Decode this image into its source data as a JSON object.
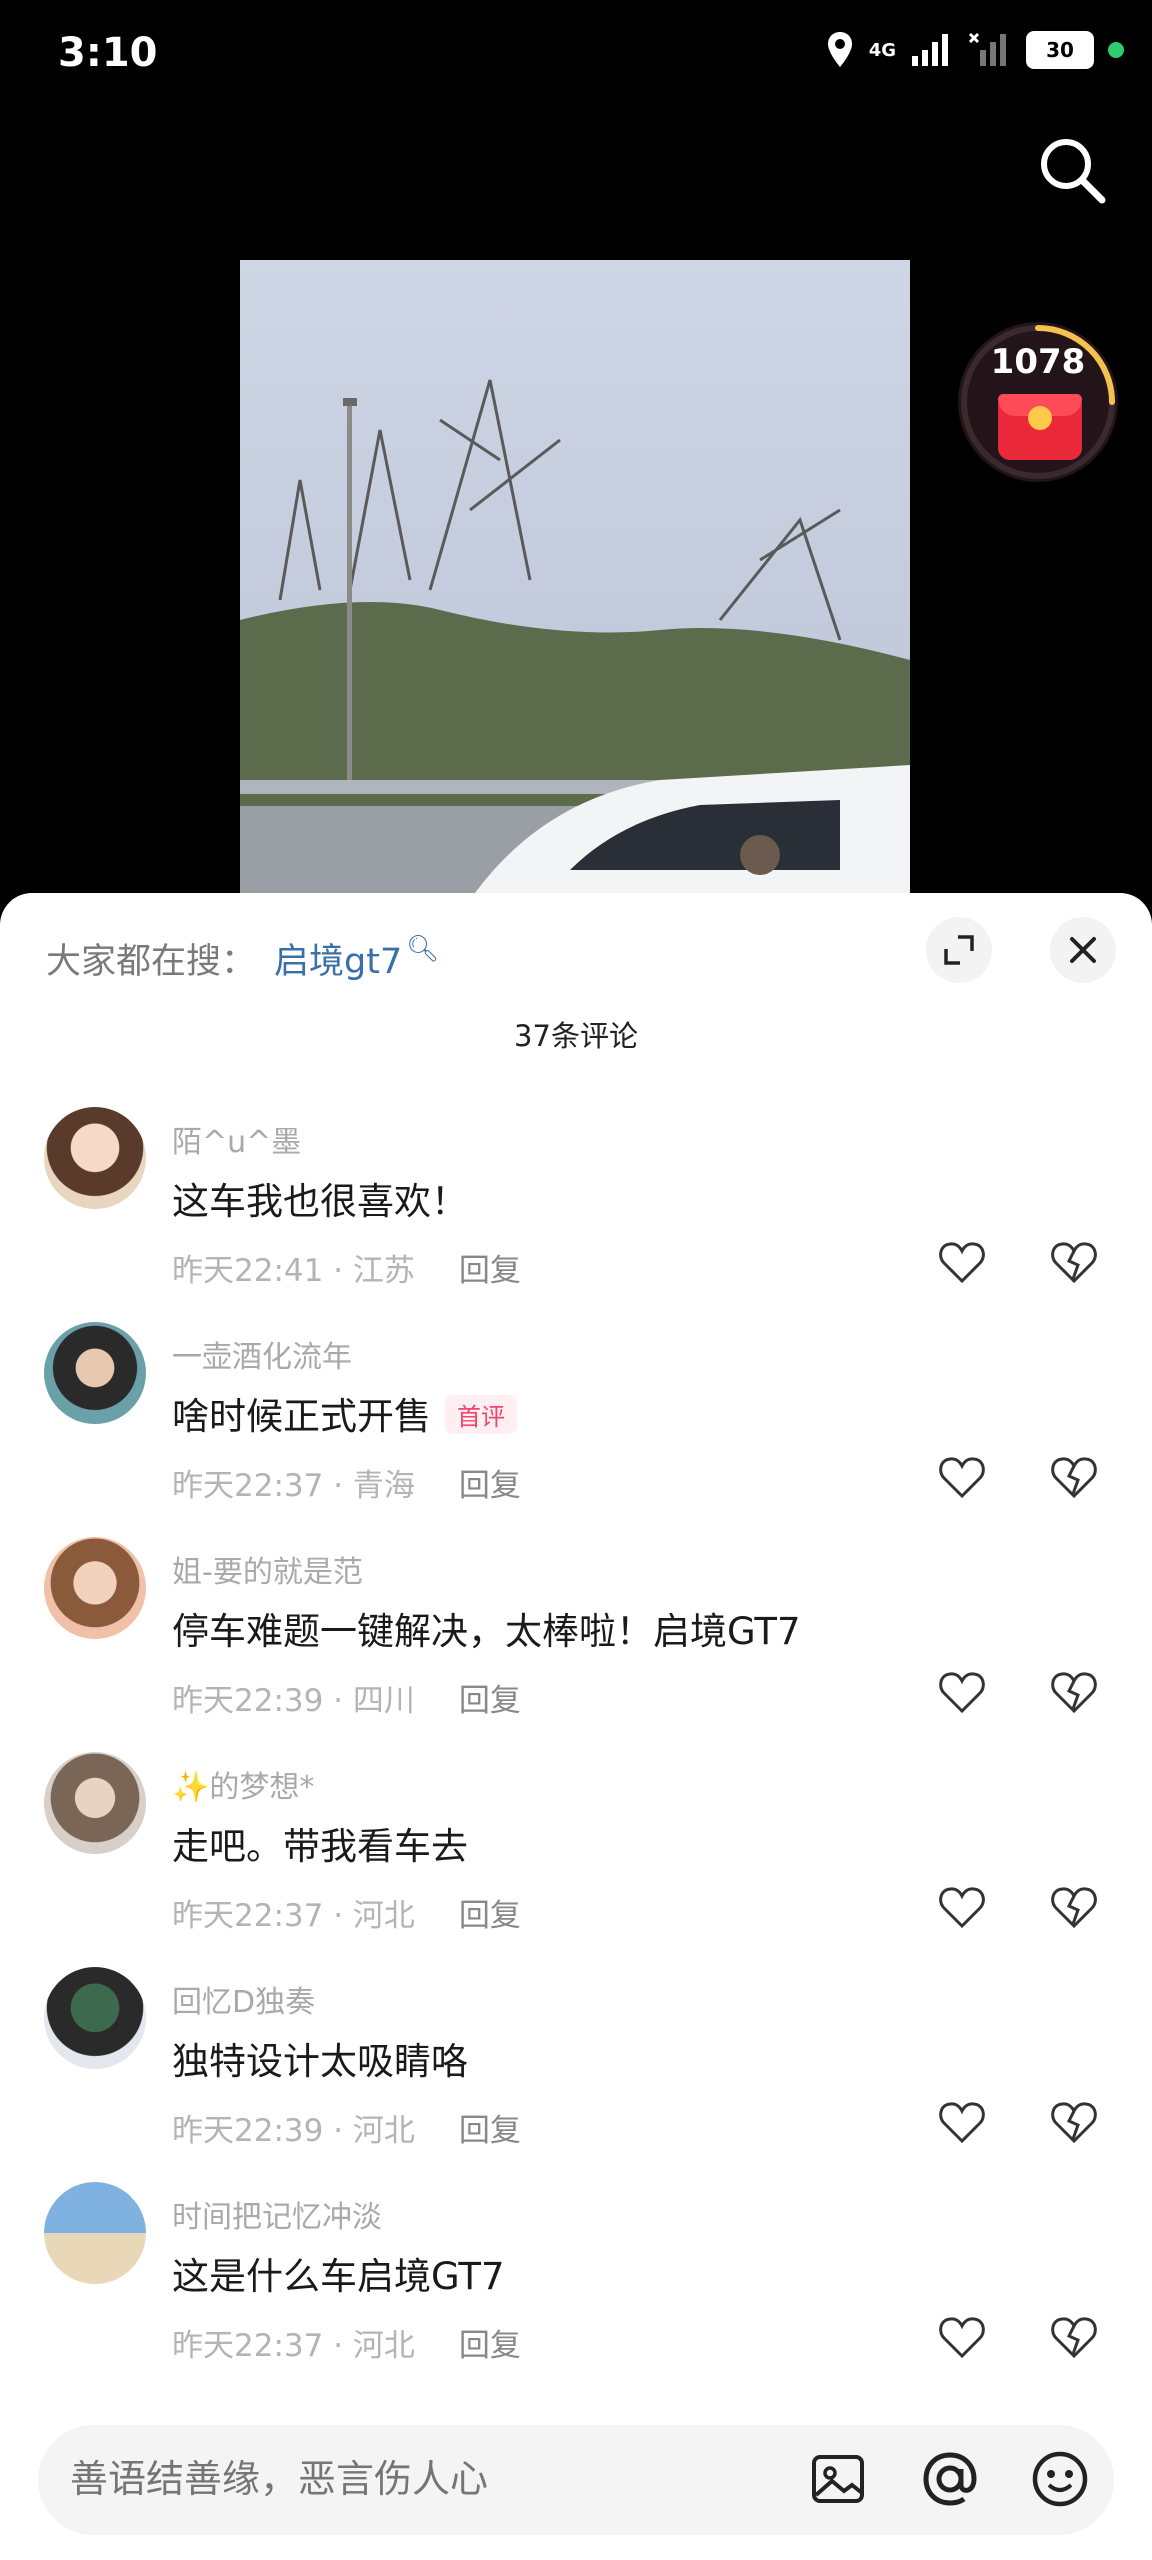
{
  "status_bar": {
    "time": "3:10",
    "network": "4G",
    "battery": "30"
  },
  "red_packet": {
    "count": "1078"
  },
  "comments_panel": {
    "hot_search_label": "大家都在搜：",
    "hot_search_keyword": "启境gt7",
    "count_label": "37条评论",
    "reply_label": "回复",
    "comments": [
      {
        "user": "陌^u^墨",
        "text": "这车我也很喜欢！",
        "time": "昨天22:41",
        "location": "江苏"
      },
      {
        "user": "一壶酒化流年",
        "text": "啥时候正式开售",
        "badge": "首评",
        "time": "昨天22:37",
        "location": "青海"
      },
      {
        "user": "姐-要的就是范",
        "text": "停车难题一键解决，太棒啦！启境GT7",
        "time": "昨天22:39",
        "location": "四川"
      },
      {
        "user": "✨的梦想*",
        "text": "走吧。带我看车去",
        "time": "昨天22:37",
        "location": "河北"
      },
      {
        "user": "回忆D独奏",
        "text": "独特设计太吸睛咯",
        "time": "昨天22:39",
        "location": "河北"
      },
      {
        "user": "时间把记忆冲淡",
        "text": "这是什么车启境GT7",
        "time": "昨天22:37",
        "location": "河北"
      }
    ]
  },
  "input_bar": {
    "placeholder": "善语结善缘，恶言伤人心"
  }
}
